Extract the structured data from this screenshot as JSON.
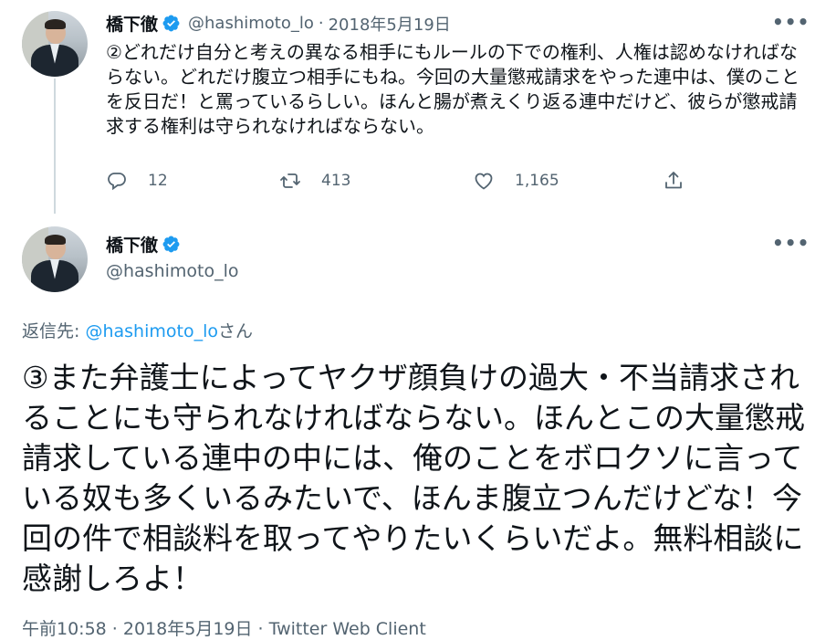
{
  "tweet1": {
    "name": "橋下徹",
    "handle": "@hashimoto_lo",
    "separator": "·",
    "date": "2018年5月19日",
    "text": "②どれだけ自分と考えの異なる相手にもルールの下での権利、人権は認めなければならない。どれだけ腹立つ相手にもね。今回の大量懲戒請求をやった連中は、僕のことを反日だ！と罵っているらしい。ほんと腸が煮えくり返る連中だけど、彼らが懲戒請求する権利は守られなければならない。",
    "reply_count": "12",
    "retweet_count": "413",
    "like_count": "1,165",
    "more": "•••"
  },
  "tweet2": {
    "name": "橋下徹",
    "handle": "@hashimoto_lo",
    "more": "•••",
    "reply_label": "返信先: ",
    "reply_handle": "@hashimoto_lo",
    "reply_suffix": "さん",
    "text": "③また弁護士によってヤクザ顔負けの過大・不当請求されることにも守られなければならない。ほんとこの大量懲戒請求している連中の中には、俺のことをボロクソに言っている奴も多くいるみたいで、ほんま腹立つんだけどな！今回の件で相談料を取ってやりたいくらいだよ。無料相談に感謝しろよ！",
    "footer": "午前10:58 · 2018年5月19日 · Twitter Web Client"
  },
  "colors": {
    "accent": "#1d9bf0",
    "secondary_text": "#536471",
    "primary_text": "#0f1419",
    "thread_line": "#cfd9de"
  },
  "icons": {
    "verified": "verified-badge-icon",
    "reply": "reply-icon",
    "retweet": "retweet-icon",
    "like": "heart-icon",
    "share": "share-icon",
    "more": "more-icon"
  }
}
